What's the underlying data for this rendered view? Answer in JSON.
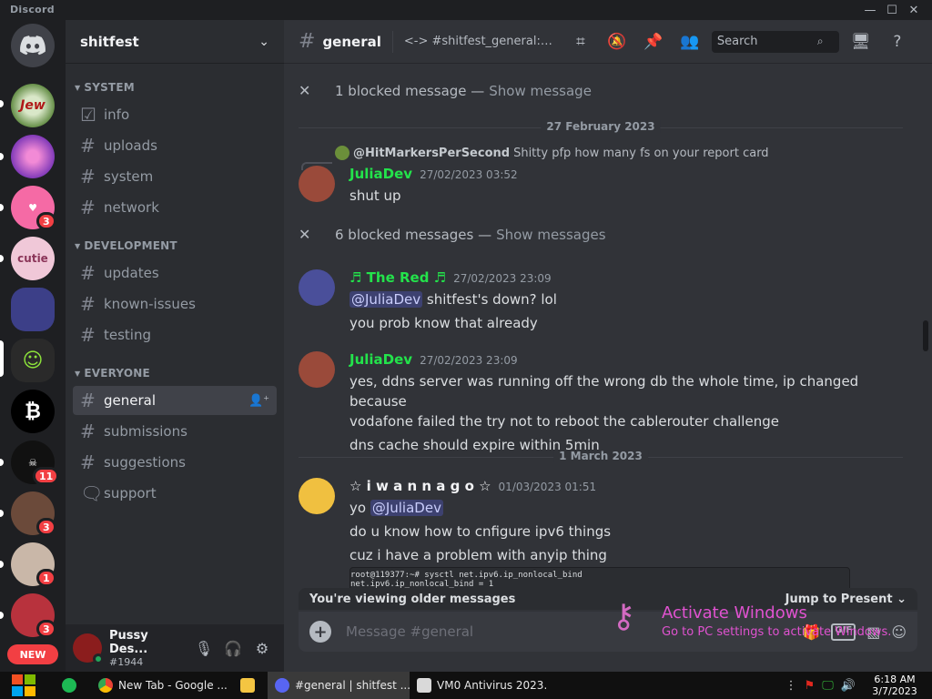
{
  "window": {
    "brand": "Discord"
  },
  "guild_badges": [
    "3",
    "11",
    "3",
    "1",
    "3"
  ],
  "guild_new": "NEW",
  "server": {
    "name": "shitfest"
  },
  "categories": [
    {
      "name": "SYSTEM",
      "channels": [
        "info",
        "uploads",
        "system",
        "network"
      ]
    },
    {
      "name": "DEVELOPMENT",
      "channels": [
        "updates",
        "known-issues",
        "testing"
      ]
    },
    {
      "name": "EVERYONE",
      "channels": [
        "general",
        "submissions",
        "suggestions",
        "support"
      ]
    }
  ],
  "user": {
    "name": "Pussy Des...",
    "tag": "#1944"
  },
  "channel_header": {
    "name": "general",
    "topic": "<-> #shitfest_general:cat....",
    "search_placeholder": "Search"
  },
  "messages": {
    "blocked_1": {
      "text": "1 blocked message —",
      "link": "Show message"
    },
    "date_1": "27 February 2023",
    "reply": {
      "author": "@HitMarkersPerSecond",
      "text": "Shitty pfp how many fs on your report card"
    },
    "m1": {
      "author": "JuliaDev",
      "time": "27/02/2023 03:52",
      "lines": [
        "shut up"
      ]
    },
    "blocked_2": {
      "text": "6 blocked messages —",
      "link": "Show messages"
    },
    "m2": {
      "author": "♬ The Red ♬",
      "time": "27/02/2023 23:09",
      "mention": "@JuliaDev",
      "line1_rest": " shitfest's down? lol",
      "line2": "you prob know that already"
    },
    "m3": {
      "author": "JuliaDev",
      "time": "27/02/2023 23:09",
      "lines": [
        "yes, ddns server was running off the wrong db the whole time, ip changed because",
        "vodafone failed the try not to reboot the cablerouter challenge",
        "dns cache should expire within 5min"
      ]
    },
    "date_2": "1 March 2023",
    "m4": {
      "author": "☆ i w a n n a g o ☆",
      "time": "01/03/2023 01:51",
      "prefix": "yo ",
      "mention": "@JuliaDev",
      "line2": "do u know how to cnfigure ipv6 things",
      "line3": "cuz i have a problem with anyip thing"
    },
    "code": [
      "root@119377:~# sysctl net.ipv6.ip_nonlocal_bind",
      "net.ipv6.ip_nonlocal_bind = 1"
    ]
  },
  "older_bar": {
    "text": "You're viewing older messages",
    "jump": "Jump to Present"
  },
  "composer": {
    "placeholder": "Message #general",
    "gif": "GIF"
  },
  "watermark": {
    "title": "Activate Windows",
    "subtitle": "Go to PC settings to activate Windows."
  },
  "taskbar": {
    "apps": [
      "New Tab - Google ...",
      "#general | shitfest ...",
      "VM0 Antivirus 2023..."
    ],
    "time": "6:18 AM",
    "date": "3/7/2023"
  },
  "colors": {
    "julia": "#23e34b",
    "thered": "#23e34b",
    "iwannago": "#f2f3f5",
    "blurple": "#5865f2"
  }
}
